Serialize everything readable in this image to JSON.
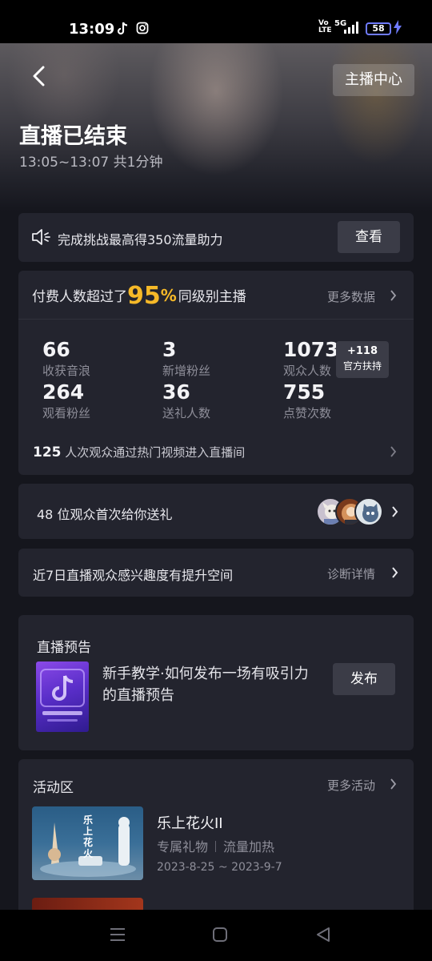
{
  "status_bar": {
    "time": "13:09",
    "network_top": "Vo",
    "network_bottom": "LTE",
    "network_5g": "5G",
    "battery": "58"
  },
  "header": {
    "back_icon": "chevron-left-icon",
    "anchor_center_label": "主播中心",
    "title": "直播已结束",
    "time_range": "13:05~13:07 共1分钟"
  },
  "challenge": {
    "icon": "speaker-icon",
    "text": "完成挑战最高得350流量助力",
    "button": "查看"
  },
  "stats": {
    "head_prefix": "付费人数超过了",
    "percent": "95",
    "percent_symbol": "%",
    "head_suffix": "同级别主播",
    "more_label": "更多数据",
    "items": [
      {
        "value": "66",
        "label": "收获音浪"
      },
      {
        "value": "3",
        "label": "新增粉丝"
      },
      {
        "value": "1073",
        "label": "观众人数"
      },
      {
        "value": "264",
        "label": "观看粉丝"
      },
      {
        "value": "36",
        "label": "送礼人数"
      },
      {
        "value": "755",
        "label": "点赞次数"
      }
    ],
    "badge": {
      "value": "+118",
      "label": "官方扶持"
    },
    "hot_count": "125",
    "hot_text": " 人次观众通过热门视频进入直播间"
  },
  "gift": {
    "text": "48 位观众首次给你送礼"
  },
  "diagnose": {
    "text": "近7日直播观众感兴趣度有提升空间",
    "more_label": "诊断详情"
  },
  "preview": {
    "title": "直播预告",
    "desc": "新手教学·如何发布一场有吸引力的直播预告",
    "button": "发布"
  },
  "activity": {
    "title": "活动区",
    "more_label": "更多活动",
    "item": {
      "name": "乐上花火II",
      "tag1": "专属礼物",
      "tag2": "流量加热",
      "date": "2023-8-25 ~ 2023-9-7",
      "thumb_text": "乐上花火"
    }
  },
  "colors": {
    "background": "#15161d",
    "card": "#23242e",
    "accent_percent": "#f6b928",
    "button": "#3b3c47"
  }
}
